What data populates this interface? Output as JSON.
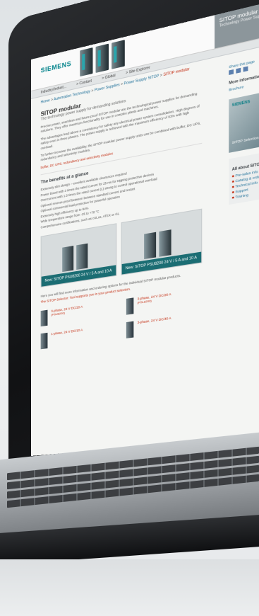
{
  "site": {
    "brand": "SIEMENS",
    "hero_title": "SITOP modular",
    "hero_subtitle": "Technology Power Supply for Demanding",
    "nav": [
      "Industry/Indust...",
      "> Contact",
      "> Global",
      "> Site Explorer"
    ],
    "breadcrumb": [
      "Home",
      "Automation Technology",
      "Power Supplies",
      "Power Supply SITOP",
      "SITOP modular"
    ]
  },
  "main": {
    "title": "SITOP modular",
    "subtitle": "The technology power supply for demanding solutions",
    "paragraphs": [
      "Precise power, seamless and future proof SITOP modular are the technological power supplies for demanding solutions. They offer maximum functionality for use in complex plants and machines.",
      "The advantages lead above a consistency for safety any electrical power system consolidation. High degrees of safety even in three phases. The power supply is achieved with the maximum efficiency of 93% with high overload.",
      "To further increase the availability, the SITOP modular power supply units can be combined with buffer, DC UPS, redundancy and selectivity modules."
    ],
    "link_text": "buffer, DC UPS, redundancy and selectivity modules",
    "benefits_title": "The benefits at a glance",
    "benefits": [
      "Extremely slim design – excellent available clearances required",
      "Power Boost with 3 times the rated current for 25 ms for tripping protective devices",
      "Overcurrent with 1.5 times the rated current (L) strong to control operational overload",
      "Optional reverse-proof between between standard current and restart",
      "Optional commercial lead protection for powerful operation",
      "Extremely high efficiency up to 94%",
      "Wide temperature range from -25 to +70 °C",
      "Comprehensive certifications, such as cULus, ATEX or GL"
    ],
    "promos": [
      {
        "caption": "New: SITOP PSU8200 24 V / 5 A and 10 A"
      },
      {
        "caption": "New: SITOP PSU8200 24 V / 5 A and 10 A"
      }
    ],
    "intro": "Here you will find more information and ordering options for the individual SITOP modular products.",
    "selector": "The SITOP Selector: Tool supports you in your product selection.",
    "products": [
      {
        "name": "3-phase, 24 V DC/20 A",
        "code": "(PSU8200)"
      },
      {
        "name": "3-phase, 24 V DC/20 A",
        "code": "(PSL8200)"
      },
      {
        "name": "1-phase, 24 V DC/10 A",
        "code": ""
      },
      {
        "name": "3-phase, 24 V DC/40 A",
        "code": ""
      }
    ]
  },
  "sidebar": {
    "share_label": "Share this page",
    "more_title": "More information",
    "brochure": "Brochure",
    "banner_brand": "SIEMENS",
    "banner_text": "SITOP Selection Tool",
    "about_title": "All about SITOP modular",
    "about_items": [
      "Pre-sales info",
      "Catalog & ordering system online",
      "Technical info",
      "Support",
      "Training"
    ]
  }
}
